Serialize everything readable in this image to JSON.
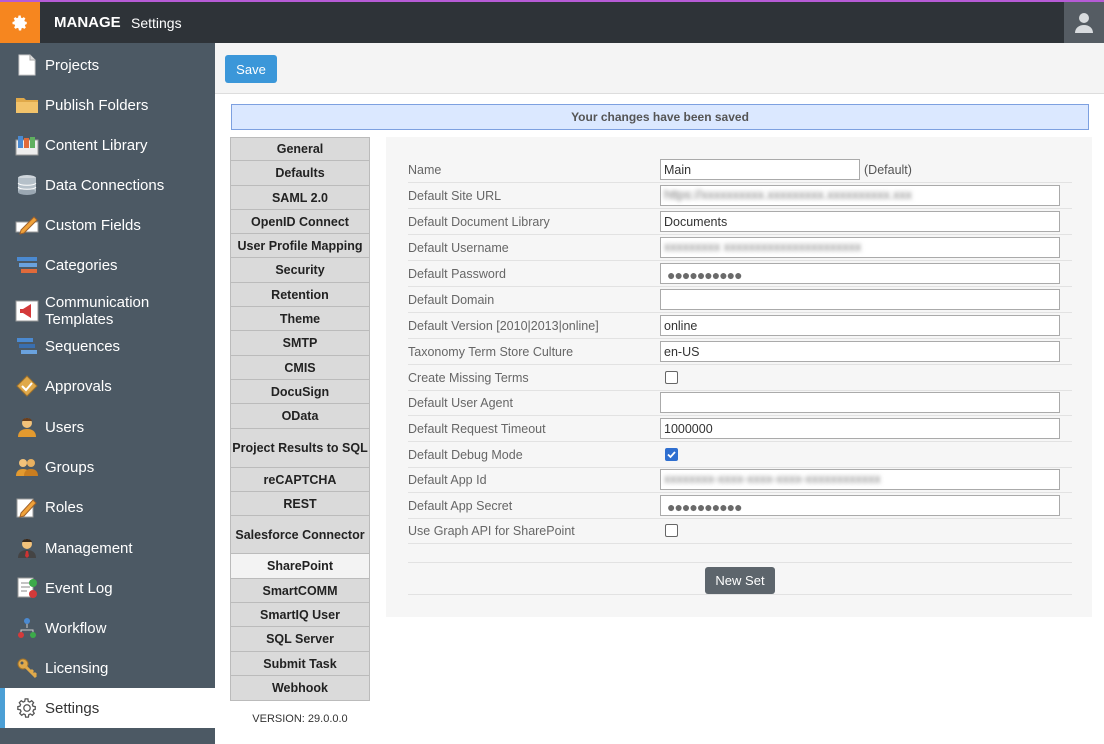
{
  "topbar": {
    "brand": "MANAGE",
    "section": "Settings"
  },
  "sidebar": {
    "items": [
      {
        "label": "Projects",
        "icon": "document-icon"
      },
      {
        "label": "Publish Folders",
        "icon": "folder-icon"
      },
      {
        "label": "Content Library",
        "icon": "library-icon"
      },
      {
        "label": "Data Connections",
        "icon": "database-icon"
      },
      {
        "label": "Custom Fields",
        "icon": "pencil-field-icon"
      },
      {
        "label": "Categories",
        "icon": "categories-icon"
      },
      {
        "label": "Communication Templates",
        "icon": "megaphone-icon"
      },
      {
        "label": "Sequences",
        "icon": "sequences-icon"
      },
      {
        "label": "Approvals",
        "icon": "approval-icon"
      },
      {
        "label": "Users",
        "icon": "user-icon"
      },
      {
        "label": "Groups",
        "icon": "group-icon"
      },
      {
        "label": "Roles",
        "icon": "roles-icon"
      },
      {
        "label": "Management",
        "icon": "manager-icon"
      },
      {
        "label": "Event Log",
        "icon": "event-log-icon"
      },
      {
        "label": "Workflow",
        "icon": "workflow-icon"
      },
      {
        "label": "Licensing",
        "icon": "key-icon"
      },
      {
        "label": "Settings",
        "icon": "gear-icon"
      }
    ]
  },
  "toolbar": {
    "save_label": "Save"
  },
  "notice": "Your changes have been saved",
  "tabs": [
    "General",
    "Defaults",
    "SAML 2.0",
    "OpenID Connect",
    "User Profile Mapping",
    "Security",
    "Retention",
    "Theme",
    "SMTP",
    "CMIS",
    "DocuSign",
    "OData",
    "Project Results to SQL",
    "reCAPTCHA",
    "REST",
    "Salesforce Connector",
    "SharePoint",
    "SmartCOMM",
    "SmartIQ User",
    "SQL Server",
    "Submit Task",
    "Webhook"
  ],
  "version": "VERSION: 29.0.0.0",
  "form": {
    "name": {
      "label": "Name",
      "value": "Main",
      "note": "(Default)"
    },
    "site_url": {
      "label": "Default Site URL",
      "value": "https://xxxxxxxxxx.xxxxxxxxx.xxxxxxxxxx.xxx"
    },
    "doc_library": {
      "label": "Default Document Library",
      "value": "Documents"
    },
    "username": {
      "label": "Default Username",
      "value": "xxxxxxxxx xxxxxxxxxxxxxxxxxxxxxx"
    },
    "password": {
      "label": "Default Password",
      "value": "●●●●●●●●●●"
    },
    "domain": {
      "label": "Default Domain",
      "value": ""
    },
    "version": {
      "label": "Default Version [2010|2013|online]",
      "value": "online"
    },
    "culture": {
      "label": "Taxonomy Term Store Culture",
      "value": "en-US"
    },
    "missing_terms": {
      "label": "Create Missing Terms",
      "checked": false
    },
    "user_agent": {
      "label": "Default User Agent",
      "value": ""
    },
    "timeout": {
      "label": "Default Request Timeout",
      "value": "1000000"
    },
    "debug": {
      "label": "Default Debug Mode",
      "checked": true
    },
    "app_id": {
      "label": "Default App Id",
      "value": "xxxxxxxx-xxxx-xxxx-xxxx-xxxxxxxxxxxx"
    },
    "app_secret": {
      "label": "Default App Secret",
      "value": "●●●●●●●●●●"
    },
    "graph_api": {
      "label": "Use Graph API for SharePoint",
      "checked": false
    }
  },
  "new_set_label": "New Set"
}
